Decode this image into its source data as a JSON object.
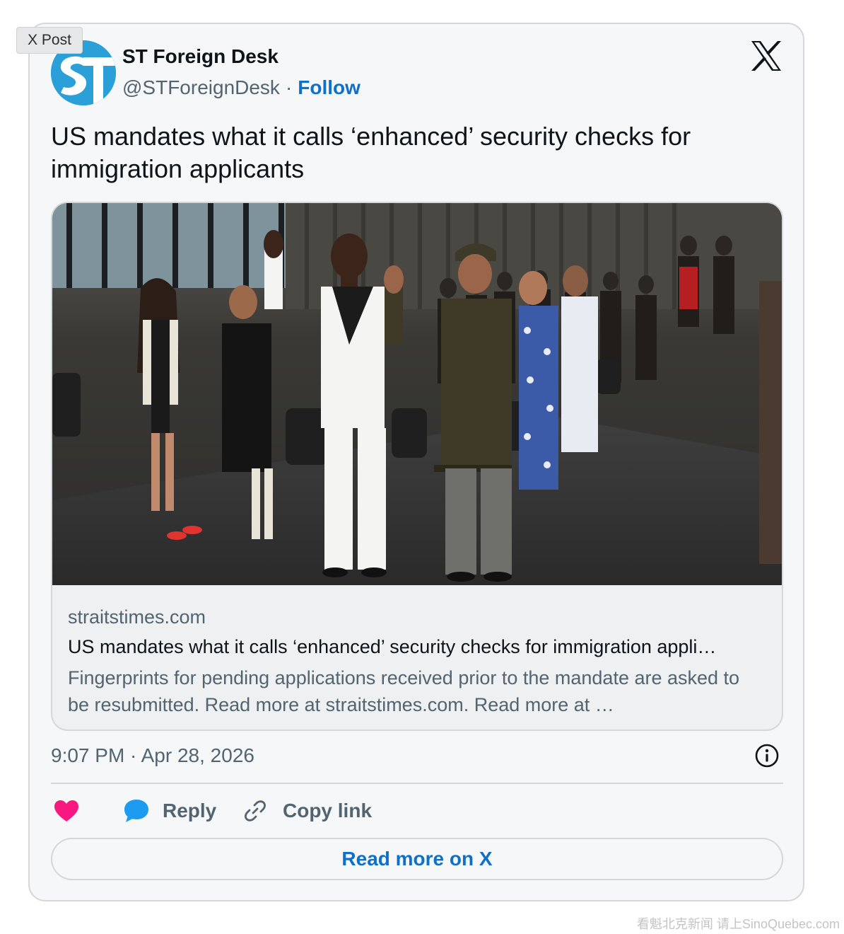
{
  "tag_label": "X Post",
  "author": {
    "name": "ST Foreign Desk",
    "handle": "@STForeignDesk",
    "separator": "·",
    "follow_label": "Follow"
  },
  "tweet": {
    "text": "US mandates what it calls ‘enhanced’ security checks for immigration applicants",
    "timestamp": "9:07 PM · Apr 28, 2026"
  },
  "link_card": {
    "domain": "straitstimes.com",
    "title": "US mandates what it calls ‘enhanced’ security checks for immigration appli…",
    "description": "Fingerprints for pending applications received prior to the mandate are asked to be resubmitted. Read more at straitstimes.com. Read more at …"
  },
  "actions": {
    "reply_label": "Reply",
    "copy_link_label": "Copy link"
  },
  "read_more_label": "Read more on X",
  "watermark": "看魁北克新闻 请上SinoQuebec.com",
  "colors": {
    "accent_blue": "#1070c8",
    "heart": "#f91880",
    "reply_bubble": "#1d9bf0",
    "muted_text": "#536471",
    "avatar_bg": "#2a9fd8"
  },
  "icons": [
    "x-logo-icon",
    "info-icon",
    "heart-icon",
    "reply-icon",
    "link-icon"
  ]
}
